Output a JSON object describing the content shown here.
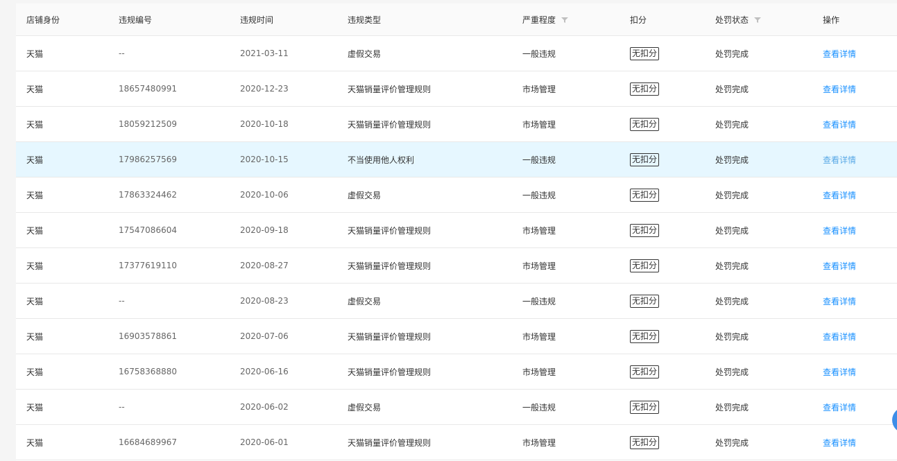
{
  "columns": [
    "店铺身份",
    "违规编号",
    "违规时间",
    "违规类型",
    "严重程度",
    "扣分",
    "处罚状态",
    "操作"
  ],
  "filter_icon": "filter-icon",
  "rows": [
    {
      "shop": "天猫",
      "id": "--",
      "date": "2021-03-11",
      "type": "虚假交易",
      "severity": "一般违规",
      "deduct": "无扣分",
      "status": "处罚完成",
      "action": "查看详情"
    },
    {
      "shop": "天猫",
      "id": "18657480991",
      "date": "2020-12-23",
      "type": "天猫销量评价管理规则",
      "severity": "市场管理",
      "deduct": "无扣分",
      "status": "处罚完成",
      "action": "查看详情"
    },
    {
      "shop": "天猫",
      "id": "18059212509",
      "date": "2020-10-18",
      "type": "天猫销量评价管理规则",
      "severity": "市场管理",
      "deduct": "无扣分",
      "status": "处罚完成",
      "action": "查看详情"
    },
    {
      "shop": "天猫",
      "id": "17986257569",
      "date": "2020-10-15",
      "type": "不当使用他人权利",
      "severity": "一般违规",
      "deduct": "无扣分",
      "status": "处罚完成",
      "action": "查看详情"
    },
    {
      "shop": "天猫",
      "id": "17863324462",
      "date": "2020-10-06",
      "type": "虚假交易",
      "severity": "一般违规",
      "deduct": "无扣分",
      "status": "处罚完成",
      "action": "查看详情"
    },
    {
      "shop": "天猫",
      "id": "17547086604",
      "date": "2020-09-18",
      "type": "天猫销量评价管理规则",
      "severity": "市场管理",
      "deduct": "无扣分",
      "status": "处罚完成",
      "action": "查看详情"
    },
    {
      "shop": "天猫",
      "id": "17377619110",
      "date": "2020-08-27",
      "type": "天猫销量评价管理规则",
      "severity": "市场管理",
      "deduct": "无扣分",
      "status": "处罚完成",
      "action": "查看详情"
    },
    {
      "shop": "天猫",
      "id": "--",
      "date": "2020-08-23",
      "type": "虚假交易",
      "severity": "一般违规",
      "deduct": "无扣分",
      "status": "处罚完成",
      "action": "查看详情"
    },
    {
      "shop": "天猫",
      "id": "16903578861",
      "date": "2020-07-06",
      "type": "天猫销量评价管理规则",
      "severity": "市场管理",
      "deduct": "无扣分",
      "status": "处罚完成",
      "action": "查看详情"
    },
    {
      "shop": "天猫",
      "id": "16758368880",
      "date": "2020-06-16",
      "type": "天猫销量评价管理规则",
      "severity": "市场管理",
      "deduct": "无扣分",
      "status": "处罚完成",
      "action": "查看详情"
    },
    {
      "shop": "天猫",
      "id": "--",
      "date": "2020-06-02",
      "type": "虚假交易",
      "severity": "一般违规",
      "deduct": "无扣分",
      "status": "处罚完成",
      "action": "查看详情"
    },
    {
      "shop": "天猫",
      "id": "16684689967",
      "date": "2020-06-01",
      "type": "天猫销量评价管理规则",
      "severity": "市场管理",
      "deduct": "无扣分",
      "status": "处罚完成",
      "action": "查看详情"
    }
  ],
  "highlighted_row": 3,
  "colors": {
    "link": "#1890ff",
    "highlight": "#e6f7ff",
    "header_bg": "#fafafa",
    "fab": "#3d8ee8"
  }
}
